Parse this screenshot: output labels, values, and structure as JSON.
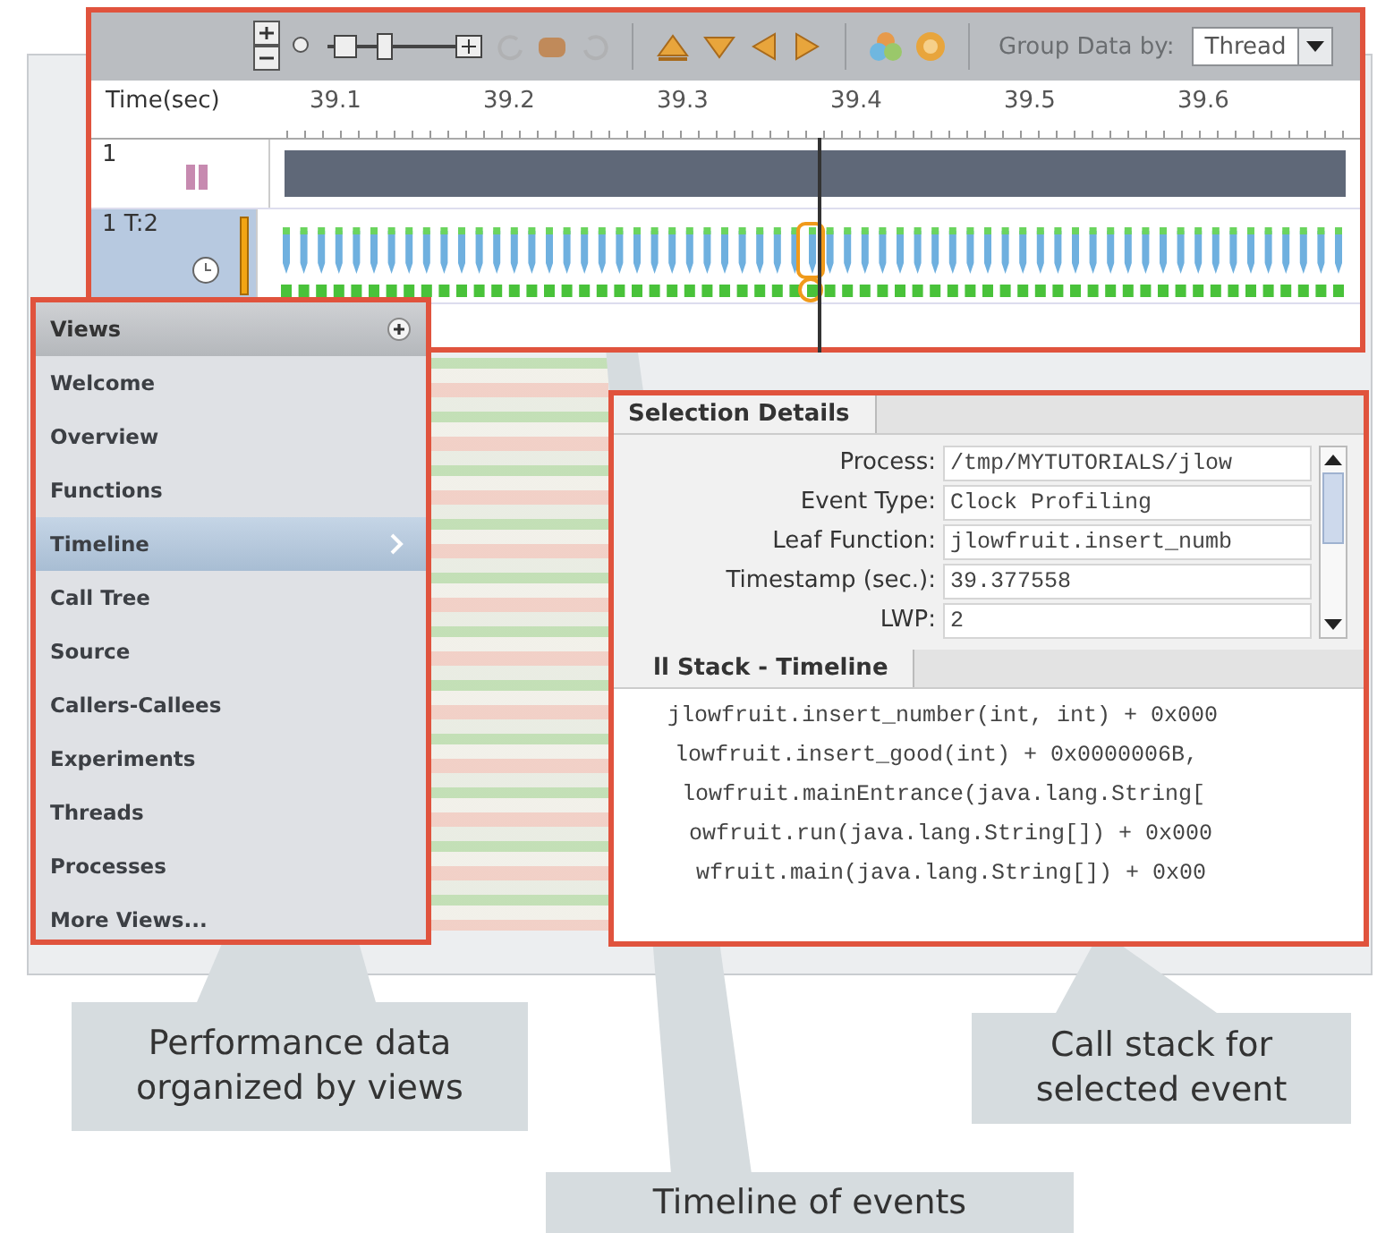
{
  "timeline": {
    "toolbar": {
      "group_label": "Group Data by:",
      "group_value": "Thread"
    },
    "ruler": {
      "label": "Time(sec)",
      "ticks": [
        "39.1",
        "39.2",
        "39.3",
        "39.4",
        "39.5",
        "39.6"
      ]
    },
    "rows": [
      {
        "label": "1",
        "kind": "process",
        "selected": false
      },
      {
        "label": "1 T:2",
        "kind": "thread",
        "selected": true
      }
    ]
  },
  "views": {
    "title": "Views",
    "items": [
      {
        "label": "Welcome",
        "selected": false
      },
      {
        "label": "Overview",
        "selected": false
      },
      {
        "label": "Functions",
        "selected": false
      },
      {
        "label": "Timeline",
        "selected": true
      },
      {
        "label": "Call Tree",
        "selected": false
      },
      {
        "label": "Source",
        "selected": false
      },
      {
        "label": "Callers-Callees",
        "selected": false
      },
      {
        "label": "Experiments",
        "selected": false
      },
      {
        "label": "Threads",
        "selected": false
      },
      {
        "label": "Processes",
        "selected": false
      },
      {
        "label": "More Views...",
        "selected": false
      }
    ]
  },
  "selection_details": {
    "tab": "Selection Details",
    "fields": [
      {
        "label": "Process:",
        "value": "/tmp/MYTUTORIALS/jlow"
      },
      {
        "label": "Event Type:",
        "value": "Clock Profiling"
      },
      {
        "label": "Leaf Function:",
        "value": "jlowfruit.insert_numb"
      },
      {
        "label": "Timestamp (sec.):",
        "value": "39.377558"
      },
      {
        "label": "LWP:",
        "value": "2"
      }
    ]
  },
  "call_stack": {
    "tab": "ll Stack - Timeline",
    "lines": [
      "jlowfruit.insert_number(int, int) + 0x000",
      "lowfruit.insert_good(int) + 0x0000006B,",
      "lowfruit.mainEntrance(java.lang.String[",
      "owfruit.run(java.lang.String[]) + 0x000",
      "wfruit.main(java.lang.String[]) + 0x00"
    ]
  },
  "callouts": [
    {
      "text": "Performance data organized by views",
      "kind": "views"
    },
    {
      "text": "Call stack for selected event",
      "kind": "stack"
    },
    {
      "text": "Timeline of events",
      "kind": "timeline"
    }
  ]
}
